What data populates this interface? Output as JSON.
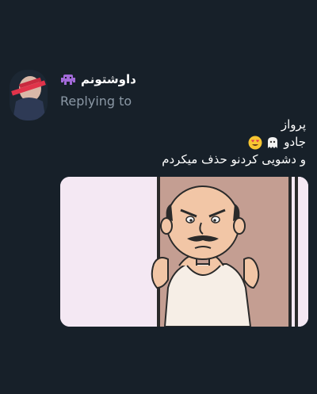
{
  "tweet": {
    "display_name": "داوشتونم",
    "name_emoji": "alien-monster-icon",
    "replying_label": "Replying to",
    "lines": [
      "پرواز",
      "جادو",
      "و دشویی کردنو حذف میکردم"
    ],
    "line2_emojis": [
      "ghost-icon",
      "heart-eyes-icon"
    ],
    "media_description_icon": "cartoon-man-gif"
  },
  "colors": {
    "background": "#172029",
    "secondary_text": "#8b98a5",
    "media_bg": "#f4e8f3",
    "door": "#c49e92"
  }
}
